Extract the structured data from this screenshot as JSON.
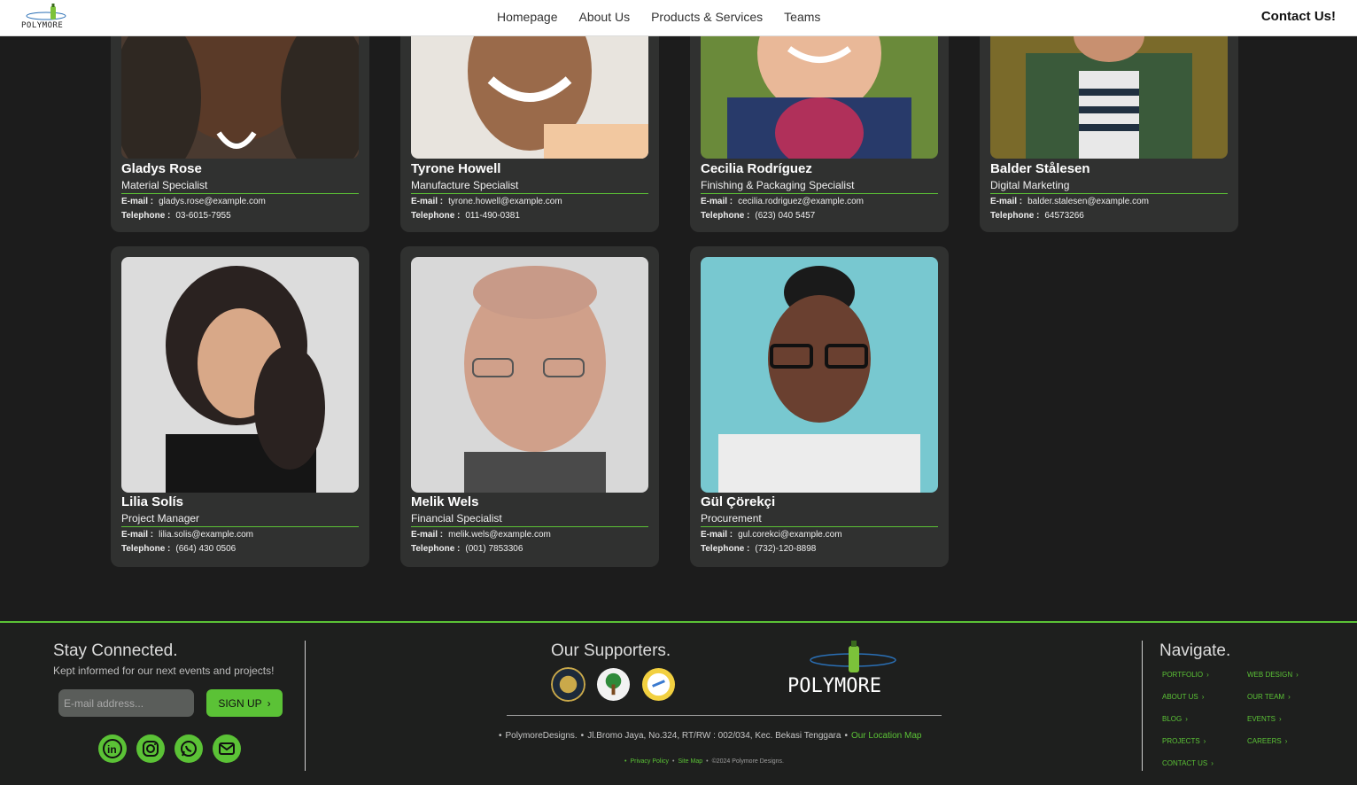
{
  "nav": {
    "logo_text": "POLYMORE",
    "links": [
      "Homepage",
      "About Us",
      "Products & Services",
      "Teams"
    ],
    "contact": "Contact Us!"
  },
  "team": [
    {
      "name": "Gladys Rose",
      "role": "Material Specialist",
      "email": "gladys.rose@example.com",
      "telephone": "03-6015-7955"
    },
    {
      "name": "Tyrone Howell",
      "role": "Manufacture Specialist",
      "email": "tyrone.howell@example.com",
      "telephone": "011-490-0381"
    },
    {
      "name": "Cecilia Rodríguez",
      "role": "Finishing & Packaging Specialist",
      "email": "cecilia.rodriguez@example.com",
      "telephone": "(623) 040 5457"
    },
    {
      "name": "Balder Stålesen",
      "role": "Digital Marketing",
      "email": "balder.stalesen@example.com",
      "telephone": "64573266"
    },
    {
      "name": "Lilia Solís",
      "role": "Project Manager",
      "email": "lilia.solis@example.com",
      "telephone": "(664) 430 0506"
    },
    {
      "name": "Melik Wels",
      "role": "Financial Specialist",
      "email": "melik.wels@example.com",
      "telephone": "(001) 7853306"
    },
    {
      "name": "Gül Çörekçi",
      "role": "Procurement",
      "email": "gul.corekci@example.com",
      "telephone": "(732)-120-8898"
    }
  ],
  "labels": {
    "email": "E-mail :",
    "telephone": "Telephone :"
  },
  "footer": {
    "stay_title": "Stay Connected.",
    "stay_sub": "Kept informed for our next events and projects!",
    "email_placeholder": "E-mail address...",
    "signup": "SIGN UP",
    "socials": [
      "linkedin-icon",
      "instagram-icon",
      "whatsapp-icon",
      "mail-icon"
    ],
    "supporters_title": "Our Supporters.",
    "brand": "POLYMORE",
    "company": "PolymoreDesigns.",
    "address": "Jl.Bromo Jaya, No.324, RT/RW : 002/034, Kec. Bekasi Tenggara",
    "location_link": "Our Location Map",
    "privacy": "Privacy Policy",
    "sitemap": "Site Map",
    "copyright": "©2024 Polymore Designs.",
    "navigate_title": "Navigate.",
    "navigate": [
      "PORTFOLIO",
      "WEB DESIGN",
      "ABOUT US",
      "OUR TEAM",
      "BLOG",
      "EVENTS",
      "PROJECTS",
      "CAREERS",
      "CONTACT US"
    ]
  },
  "colors": {
    "accent": "#5bc236",
    "card": "#303130",
    "background": "#1c1c1c"
  }
}
